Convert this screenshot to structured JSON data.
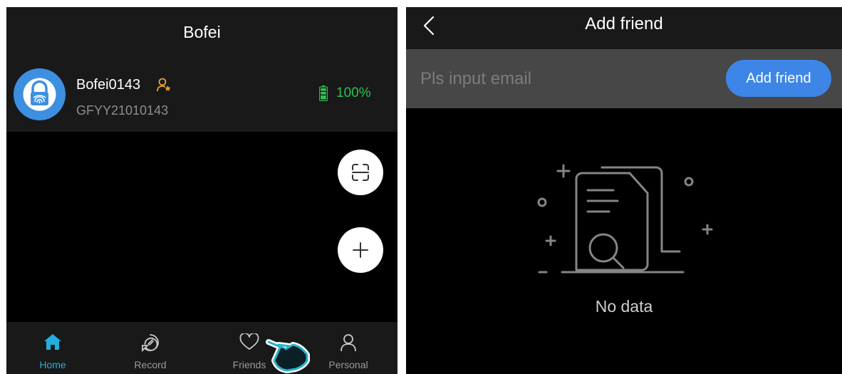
{
  "home_screen": {
    "title": "Bofei",
    "device": {
      "name": "Bofei0143",
      "id": "GFYY21010143",
      "battery": "100%",
      "icon": "fingerprint-lock-icon",
      "role_icon": "admin-user-icon"
    },
    "actions": {
      "scan_icon": "scan-icon",
      "add_icon": "plus-icon"
    },
    "tabs": [
      {
        "label": "Home",
        "icon": "home-icon",
        "active": true
      },
      {
        "label": "Record",
        "icon": "record-icon",
        "active": false
      },
      {
        "label": "Friends",
        "icon": "heart-icon",
        "active": false
      },
      {
        "label": "Personal",
        "icon": "person-icon",
        "active": false
      }
    ]
  },
  "add_friend_screen": {
    "title": "Add friend",
    "email_placeholder": "Pls input email",
    "email_value": "",
    "add_button": "Add friend",
    "empty_text": "No data"
  },
  "colors": {
    "accent_blue": "#3d86e8",
    "active_tab": "#22aee0",
    "battery_green": "#2fbf52",
    "admin_orange": "#e8a13a"
  }
}
